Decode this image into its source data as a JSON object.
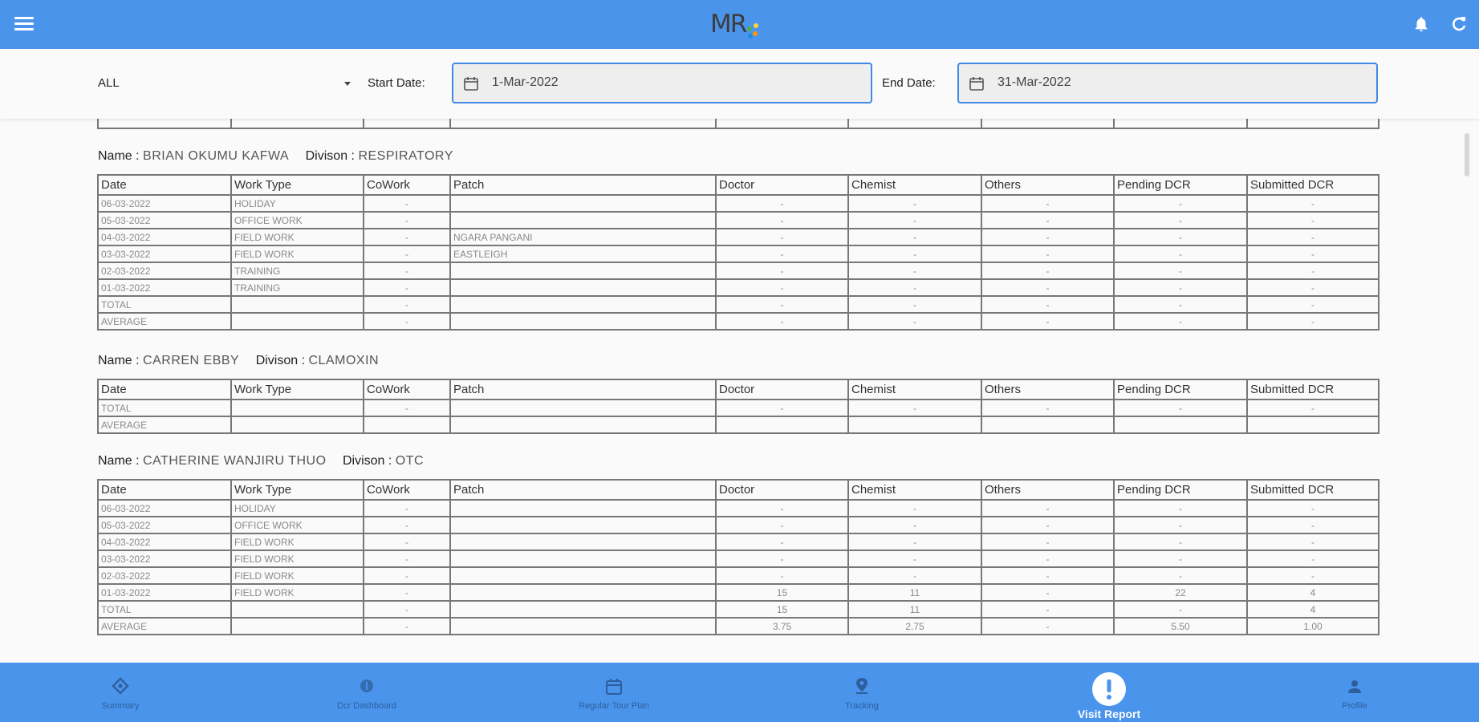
{
  "app": {
    "logo_text": "MR"
  },
  "filters": {
    "division_select": "ALL",
    "start_label": "Start Date:",
    "start_value": "1-Mar-2022",
    "end_label": "End Date:",
    "end_value": "31-Mar-2022"
  },
  "table_columns": [
    "Date",
    "Work Type",
    "CoWork",
    "Patch",
    "Doctor",
    "Chemist",
    "Others",
    "Pending DCR",
    "Submitted DCR"
  ],
  "reports": [
    {
      "name_label": "Name :",
      "name": "BRIAN OKUMU KAFWA",
      "division_label": "Divison :",
      "division": "RESPIRATORY",
      "rows": [
        [
          "06-03-2022",
          "HOLIDAY",
          "-",
          "",
          "-",
          "-",
          "-",
          "-",
          "-"
        ],
        [
          "05-03-2022",
          "OFFICE WORK",
          "-",
          "",
          "-",
          "-",
          "-",
          "-",
          "-"
        ],
        [
          "04-03-2022",
          "FIELD WORK",
          "-",
          "NGARA PANGANI",
          "-",
          "-",
          "-",
          "-",
          "-"
        ],
        [
          "03-03-2022",
          "FIELD WORK",
          "-",
          "EASTLEIGH",
          "-",
          "-",
          "-",
          "-",
          "-"
        ],
        [
          "02-03-2022",
          "TRAINING",
          "-",
          "",
          "-",
          "-",
          "-",
          "-",
          "-"
        ],
        [
          "01-03-2022",
          "TRAINING",
          "-",
          "",
          "-",
          "-",
          "-",
          "-",
          "-"
        ],
        [
          "TOTAL",
          "",
          "-",
          "",
          "-",
          "-",
          "-",
          "-",
          "-"
        ],
        [
          "AVERAGE",
          "",
          "-",
          "",
          "-",
          "-",
          "-",
          "-",
          "-"
        ]
      ]
    },
    {
      "name_label": "Name :",
      "name": "CARREN EBBY",
      "division_label": "Divison :",
      "division": "CLAMOXIN",
      "rows": [
        [
          "TOTAL",
          "",
          "-",
          "",
          "-",
          "-",
          "-",
          "-",
          "-"
        ],
        [
          "AVERAGE",
          "",
          "",
          "",
          "",
          "",
          "",
          "",
          ""
        ]
      ]
    },
    {
      "name_label": "Name :",
      "name": "CATHERINE WANJIRU THUO",
      "division_label": "Divison :",
      "division": "OTC",
      "rows": [
        [
          "06-03-2022",
          "HOLIDAY",
          "-",
          "",
          "-",
          "-",
          "-",
          "-",
          "-"
        ],
        [
          "05-03-2022",
          "OFFICE WORK",
          "-",
          "",
          "-",
          "-",
          "-",
          "-",
          "-"
        ],
        [
          "04-03-2022",
          "FIELD WORK",
          "-",
          "",
          "-",
          "-",
          "-",
          "-",
          "-"
        ],
        [
          "03-03-2022",
          "FIELD WORK",
          "-",
          "",
          "-",
          "-",
          "-",
          "-",
          "-"
        ],
        [
          "02-03-2022",
          "FIELD WORK",
          "-",
          "",
          "-",
          "-",
          "-",
          "-",
          "-"
        ],
        [
          "01-03-2022",
          "FIELD WORK",
          "-",
          "",
          "15",
          "11",
          "-",
          "22",
          "4"
        ],
        [
          "TOTAL",
          "",
          "-",
          "",
          "15",
          "11",
          "-",
          "-",
          "4"
        ],
        [
          "AVERAGE",
          "",
          "-",
          "",
          "3.75",
          "2.75",
          "-",
          "5.50",
          "1.00"
        ]
      ]
    }
  ],
  "bottom_nav": [
    {
      "label": "Summary",
      "icon": "summary-icon"
    },
    {
      "label": "Dcr Dashboard",
      "icon": "dashboard-icon"
    },
    {
      "label": "Regular Tour Plan",
      "icon": "calendar-icon"
    },
    {
      "label": "Tracking",
      "icon": "location-pin-icon"
    },
    {
      "label": "Visit Report",
      "icon": "alert-circle-icon"
    },
    {
      "label": "Profile",
      "icon": "person-icon"
    }
  ],
  "colors": {
    "primary": "#4a94ec",
    "active_nav": "#ffffff",
    "border": "#777777"
  }
}
